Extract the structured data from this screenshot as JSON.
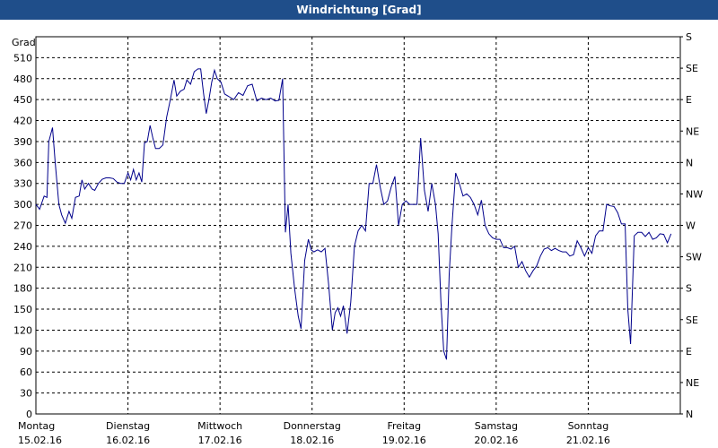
{
  "chart_data": {
    "type": "line",
    "title": "Windrichtung [Grad]",
    "ylabel": "Grad",
    "ylim": [
      0,
      540
    ],
    "y_ticks": [
      0,
      30,
      60,
      90,
      120,
      150,
      180,
      210,
      240,
      270,
      300,
      330,
      360,
      390,
      420,
      450,
      480,
      510
    ],
    "right_labels": [
      "N",
      "NE",
      "E",
      "SE",
      "S",
      "SW",
      "W",
      "NW",
      "N",
      "NE",
      "E",
      "SE",
      "S"
    ],
    "x_days": [
      {
        "day": "Montag",
        "date": "15.02.16"
      },
      {
        "day": "Dienstag",
        "date": "16.02.16"
      },
      {
        "day": "Mittwoch",
        "date": "17.02.16"
      },
      {
        "day": "Donnerstag",
        "date": "18.02.16"
      },
      {
        "day": "Freitag",
        "date": "19.02.16"
      },
      {
        "day": "Samstag",
        "date": "20.02.16"
      },
      {
        "day": "Sonntag",
        "date": "21.02.16"
      }
    ],
    "xlim_days": [
      0,
      7
    ],
    "grid": true,
    "series_color": "#00008b",
    "series": [
      {
        "values": [
          [
            0.0,
            300
          ],
          [
            0.04,
            293
          ],
          [
            0.09,
            312
          ],
          [
            0.12,
            310
          ],
          [
            0.14,
            390
          ],
          [
            0.18,
            410
          ],
          [
            0.21,
            360
          ],
          [
            0.25,
            300
          ],
          [
            0.28,
            285
          ],
          [
            0.32,
            273
          ],
          [
            0.36,
            290
          ],
          [
            0.39,
            280
          ],
          [
            0.43,
            310
          ],
          [
            0.47,
            312
          ],
          [
            0.5,
            335
          ],
          [
            0.53,
            322
          ],
          [
            0.57,
            330
          ],
          [
            0.61,
            322
          ],
          [
            0.64,
            320
          ],
          [
            0.68,
            330
          ],
          [
            0.72,
            336
          ],
          [
            0.76,
            338
          ],
          [
            0.8,
            338
          ],
          [
            0.84,
            337
          ],
          [
            0.88,
            332
          ],
          [
            0.92,
            330
          ],
          [
            0.96,
            330
          ],
          [
            1.0,
            345
          ],
          [
            1.03,
            335
          ],
          [
            1.06,
            350
          ],
          [
            1.09,
            335
          ],
          [
            1.12,
            345
          ],
          [
            1.15,
            332
          ],
          [
            1.18,
            388
          ],
          [
            1.21,
            390
          ],
          [
            1.24,
            413
          ],
          [
            1.27,
            395
          ],
          [
            1.3,
            380
          ],
          [
            1.34,
            380
          ],
          [
            1.38,
            385
          ],
          [
            1.42,
            425
          ],
          [
            1.46,
            450
          ],
          [
            1.5,
            478
          ],
          [
            1.53,
            455
          ],
          [
            1.57,
            462
          ],
          [
            1.61,
            465
          ],
          [
            1.64,
            478
          ],
          [
            1.68,
            472
          ],
          [
            1.72,
            490
          ],
          [
            1.76,
            494
          ],
          [
            1.79,
            494
          ],
          [
            1.82,
            460
          ],
          [
            1.85,
            430
          ],
          [
            1.88,
            450
          ],
          [
            1.91,
            475
          ],
          [
            1.94,
            492
          ],
          [
            1.97,
            480
          ],
          [
            2.01,
            475
          ],
          [
            2.05,
            458
          ],
          [
            2.1,
            454
          ],
          [
            2.15,
            450
          ],
          [
            2.2,
            460
          ],
          [
            2.25,
            456
          ],
          [
            2.3,
            470
          ],
          [
            2.35,
            472
          ],
          [
            2.4,
            448
          ],
          [
            2.45,
            452
          ],
          [
            2.5,
            450
          ],
          [
            2.55,
            452
          ],
          [
            2.6,
            448
          ],
          [
            2.64,
            449
          ],
          [
            2.68,
            480
          ],
          [
            2.71,
            260
          ],
          [
            2.74,
            300
          ],
          [
            2.77,
            230
          ],
          [
            2.81,
            180
          ],
          [
            2.85,
            140
          ],
          [
            2.88,
            122
          ],
          [
            2.92,
            220
          ],
          [
            2.96,
            250
          ],
          [
            2.99,
            235
          ],
          [
            3.02,
            232
          ],
          [
            3.06,
            235
          ],
          [
            3.1,
            232
          ],
          [
            3.14,
            237
          ],
          [
            3.18,
            185
          ],
          [
            3.22,
            120
          ],
          [
            3.25,
            145
          ],
          [
            3.28,
            152
          ],
          [
            3.31,
            140
          ],
          [
            3.34,
            155
          ],
          [
            3.38,
            115
          ],
          [
            3.42,
            160
          ],
          [
            3.46,
            240
          ],
          [
            3.5,
            262
          ],
          [
            3.54,
            270
          ],
          [
            3.58,
            262
          ],
          [
            3.62,
            330
          ],
          [
            3.66,
            330
          ],
          [
            3.7,
            357
          ],
          [
            3.74,
            325
          ],
          [
            3.78,
            300
          ],
          [
            3.82,
            305
          ],
          [
            3.86,
            325
          ],
          [
            3.9,
            340
          ],
          [
            3.94,
            270
          ],
          [
            3.98,
            300
          ],
          [
            4.02,
            305
          ],
          [
            4.06,
            300
          ],
          [
            4.1,
            300
          ],
          [
            4.14,
            300
          ],
          [
            4.18,
            395
          ],
          [
            4.22,
            320
          ],
          [
            4.26,
            290
          ],
          [
            4.3,
            330
          ],
          [
            4.34,
            300
          ],
          [
            4.37,
            258
          ],
          [
            4.4,
            160
          ],
          [
            4.43,
            90
          ],
          [
            4.46,
            78
          ],
          [
            4.49,
            200
          ],
          [
            4.52,
            270
          ],
          [
            4.56,
            345
          ],
          [
            4.6,
            330
          ],
          [
            4.64,
            312
          ],
          [
            4.68,
            315
          ],
          [
            4.72,
            310
          ],
          [
            4.76,
            300
          ],
          [
            4.8,
            285
          ],
          [
            4.84,
            306
          ],
          [
            4.88,
            270
          ],
          [
            4.92,
            258
          ],
          [
            4.96,
            252
          ],
          [
            5.0,
            250
          ],
          [
            5.04,
            250
          ],
          [
            5.08,
            238
          ],
          [
            5.12,
            238
          ],
          [
            5.16,
            236
          ],
          [
            5.2,
            240
          ],
          [
            5.24,
            210
          ],
          [
            5.28,
            218
          ],
          [
            5.32,
            205
          ],
          [
            5.36,
            196
          ],
          [
            5.4,
            205
          ],
          [
            5.44,
            212
          ],
          [
            5.48,
            226
          ],
          [
            5.52,
            236
          ],
          [
            5.56,
            238
          ],
          [
            5.6,
            234
          ],
          [
            5.64,
            237
          ],
          [
            5.68,
            234
          ],
          [
            5.72,
            232
          ],
          [
            5.76,
            232
          ],
          [
            5.8,
            226
          ],
          [
            5.84,
            228
          ],
          [
            5.88,
            248
          ],
          [
            5.92,
            238
          ],
          [
            5.96,
            226
          ],
          [
            6.0,
            238
          ],
          [
            6.04,
            230
          ],
          [
            6.08,
            255
          ],
          [
            6.12,
            262
          ],
          [
            6.16,
            262
          ],
          [
            6.2,
            300
          ],
          [
            6.24,
            298
          ],
          [
            6.28,
            297
          ],
          [
            6.32,
            288
          ],
          [
            6.36,
            272
          ],
          [
            6.4,
            272
          ],
          [
            6.43,
            150
          ],
          [
            6.46,
            100
          ],
          [
            6.5,
            255
          ],
          [
            6.54,
            260
          ],
          [
            6.58,
            260
          ],
          [
            6.62,
            254
          ],
          [
            6.66,
            260
          ],
          [
            6.7,
            250
          ],
          [
            6.74,
            252
          ],
          [
            6.78,
            258
          ],
          [
            6.82,
            257
          ],
          [
            6.86,
            245
          ],
          [
            6.9,
            258
          ]
        ]
      }
    ]
  }
}
